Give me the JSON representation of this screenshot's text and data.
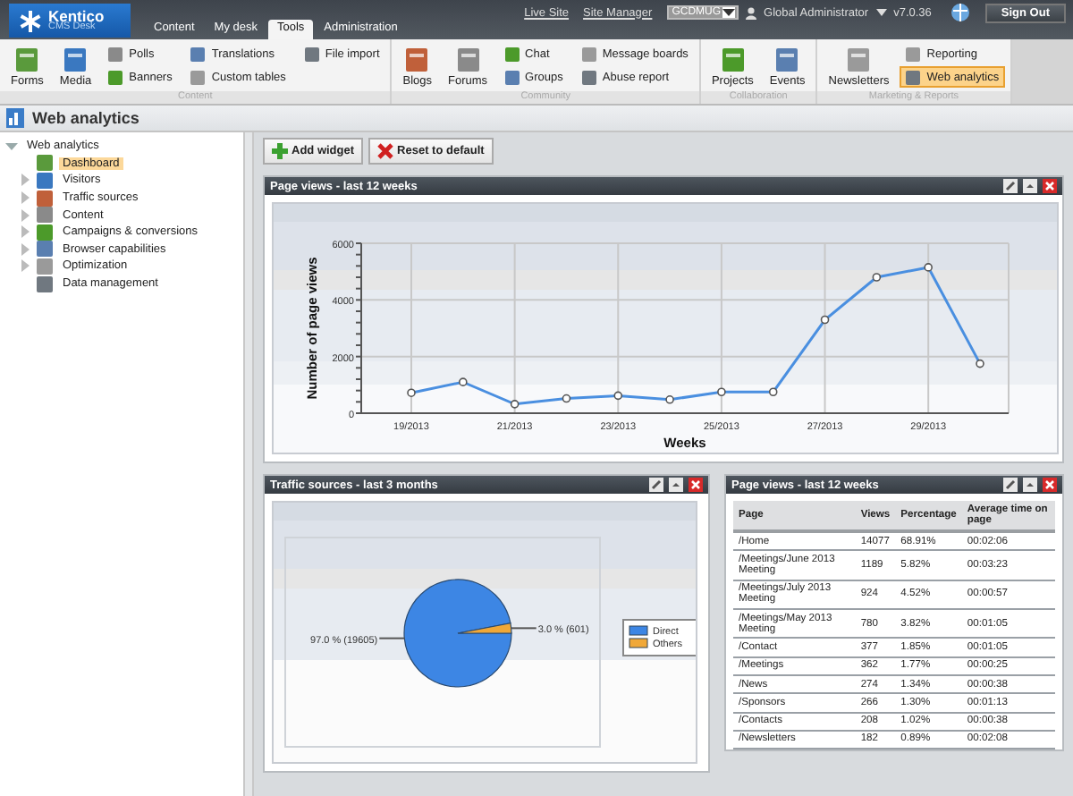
{
  "header": {
    "logo": {
      "title": "Kentico",
      "subtitle": "CMS Desk"
    },
    "tabs": [
      {
        "label": "Content",
        "selected": false
      },
      {
        "label": "My desk",
        "selected": false
      },
      {
        "label": "Tools",
        "selected": true
      },
      {
        "label": "Administration",
        "selected": false
      }
    ],
    "links": [
      "Live Site",
      "Site Manager"
    ],
    "site_select": {
      "value": "GCDMUG"
    },
    "user": "Global Administrator",
    "version": "v7.0.36",
    "sign_out": "Sign Out"
  },
  "ribbon": [
    {
      "label": "Content",
      "large": [
        {
          "label": "Forms",
          "selected": false
        },
        {
          "label": "Media",
          "selected": false
        }
      ],
      "small": [
        {
          "label": "Polls",
          "selected": false
        },
        {
          "label": "Banners",
          "selected": false
        },
        {
          "label": "Translations",
          "selected": false
        },
        {
          "label": "Custom tables",
          "selected": false
        },
        {
          "label": "File import",
          "selected": false
        }
      ]
    },
    {
      "label": "Community",
      "large": [
        {
          "label": "Blogs",
          "selected": false
        },
        {
          "label": "Forums",
          "selected": false
        }
      ],
      "small": [
        {
          "label": "Chat",
          "selected": false
        },
        {
          "label": "Groups",
          "selected": false
        },
        {
          "label": "Message boards",
          "selected": false
        },
        {
          "label": "Abuse report",
          "selected": false
        }
      ]
    },
    {
      "label": "Collaboration",
      "large": [
        {
          "label": "Projects",
          "selected": false
        },
        {
          "label": "Events",
          "selected": false
        }
      ]
    },
    {
      "label": "Marketing & Reports",
      "large": [
        {
          "label": "Newsletters",
          "selected": false
        }
      ],
      "small": [
        {
          "label": "Reporting",
          "selected": false
        },
        {
          "label": "Web analytics",
          "selected": true
        }
      ]
    }
  ],
  "page_title": "Web analytics",
  "tree": {
    "label": "Web analytics",
    "expanded": true,
    "children": [
      {
        "label": "Dashboard",
        "selected": true,
        "expandable": false
      },
      {
        "label": "Visitors",
        "selected": false,
        "expandable": true
      },
      {
        "label": "Traffic sources",
        "selected": false,
        "expandable": true
      },
      {
        "label": "Content",
        "selected": false,
        "expandable": true
      },
      {
        "label": "Campaigns & conversions",
        "selected": false,
        "expandable": true
      },
      {
        "label": "Browser capabilities",
        "selected": false,
        "expandable": true
      },
      {
        "label": "Optimization",
        "selected": false,
        "expandable": true
      },
      {
        "label": "Data management",
        "selected": false,
        "expandable": false
      }
    ]
  },
  "toolbar": [
    "Add widget",
    "Reset to default"
  ],
  "line_widget": {
    "title": "Page views - last 12 weeks",
    "chart_data": {
      "type": "line",
      "xlabel": "Weeks",
      "ylabel": "Number of page views",
      "categories": [
        "19/2013",
        null,
        "21/2013",
        null,
        "23/2013",
        null,
        "25/2013",
        null,
        "27/2013",
        null,
        "29/2013",
        null
      ],
      "grid": true,
      "series": [
        {
          "color": "#4a8fe0",
          "marker": "circle",
          "values": [
            720,
            1100,
            320,
            520,
            620,
            480,
            750,
            750,
            3300,
            4800,
            5150,
            1750
          ]
        }
      ],
      "ylim": [
        0,
        6000
      ],
      "yticks": [
        0,
        2000,
        4000,
        6000
      ]
    }
  },
  "pie_widget": {
    "title": "Traffic sources - last 3 months",
    "chart_data": {
      "type": "pie",
      "categories": [
        "Direct",
        "Others"
      ],
      "series": [
        {
          "values": [
            97.0,
            3.0
          ]
        }
      ],
      "colors": [
        "#3d86e4",
        "#f0a838"
      ],
      "legend": "right",
      "value_labels": [
        "97.0 % (19605)",
        "3.0 % (601)"
      ]
    }
  },
  "table_widget": {
    "title": "Page views - last 12 weeks",
    "columns": [
      "Page",
      "Views",
      "Percentage",
      "Average time on page"
    ],
    "rows": [
      [
        "/Home",
        "14077",
        "68.91%",
        "00:02:06"
      ],
      [
        "/Meetings/June 2013 Meeting",
        "1189",
        "5.82%",
        "00:03:23"
      ],
      [
        "/Meetings/July 2013 Meeting",
        "924",
        "4.52%",
        "00:00:57"
      ],
      [
        "/Meetings/May 2013 Meeting",
        "780",
        "3.82%",
        "00:01:05"
      ],
      [
        "/Contact",
        "377",
        "1.85%",
        "00:01:05"
      ],
      [
        "/Meetings",
        "362",
        "1.77%",
        "00:00:25"
      ],
      [
        "/News",
        "274",
        "1.34%",
        "00:00:38"
      ],
      [
        "/Sponsors",
        "266",
        "1.30%",
        "00:01:13"
      ],
      [
        "/Contacts",
        "208",
        "1.02%",
        "00:00:38"
      ],
      [
        "/Newsletters",
        "182",
        "0.89%",
        "00:02:08"
      ]
    ]
  }
}
